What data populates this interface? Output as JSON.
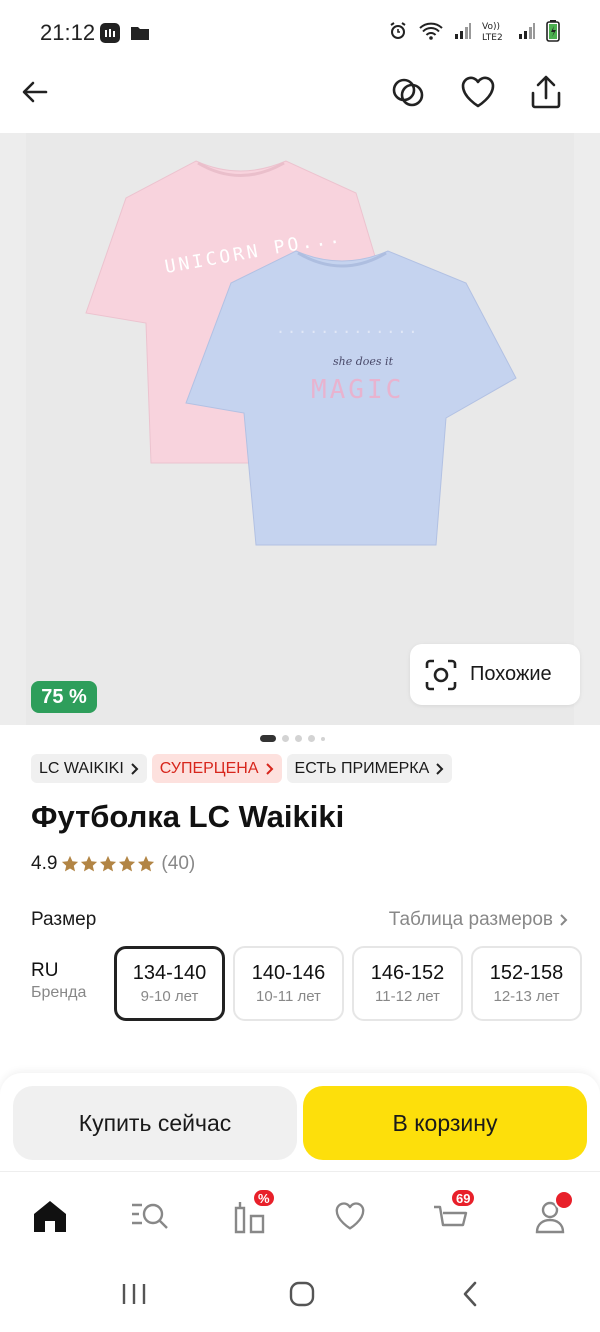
{
  "status_bar": {
    "time": "21:12"
  },
  "gallery": {
    "discount_badge": "75 %",
    "similar_label": "Похожие",
    "slide_count": 5,
    "active_slide": 1,
    "print_pink": "UNICORN PO...",
    "print_blue_small": "she does it",
    "print_blue_big": "MAGIC"
  },
  "chips": [
    {
      "label": "LC WAIKIKI",
      "accent": false
    },
    {
      "label": "СУПЕРЦЕНА",
      "accent": true
    },
    {
      "label": "ЕСТЬ ПРИМЕРКА",
      "accent": false
    }
  ],
  "product": {
    "title": "Футболка LC Waikiki",
    "rating": "4.9",
    "rating_stars": 5,
    "reviews": "(40)"
  },
  "size": {
    "label": "Размер",
    "table_link": "Таблица размеров",
    "system_main": "RU",
    "system_sub": "Бренда",
    "options": [
      {
        "value": "134-140",
        "age": "9-10 лет",
        "selected": true
      },
      {
        "value": "140-146",
        "age": "10-11 лет",
        "selected": false
      },
      {
        "value": "146-152",
        "age": "11-12 лет",
        "selected": false
      },
      {
        "value": "152-158",
        "age": "12-13 лет",
        "selected": false
      }
    ]
  },
  "actions": {
    "buy_now": "Купить сейчас",
    "add_to_cart": "В корзину"
  },
  "bottom_nav": {
    "items": [
      "home-icon",
      "catalog-search-icon",
      "promo-icon",
      "favorites-icon",
      "cart-icon",
      "profile-icon"
    ],
    "promo_badge": "%",
    "cart_badge": "69"
  },
  "colors": {
    "accent_yellow": "#fddf0b",
    "discount_green": "#2e9e5b",
    "badge_red": "#e8202a",
    "chip_red_text": "#d7261c",
    "chip_red_bg": "#fde1de"
  }
}
